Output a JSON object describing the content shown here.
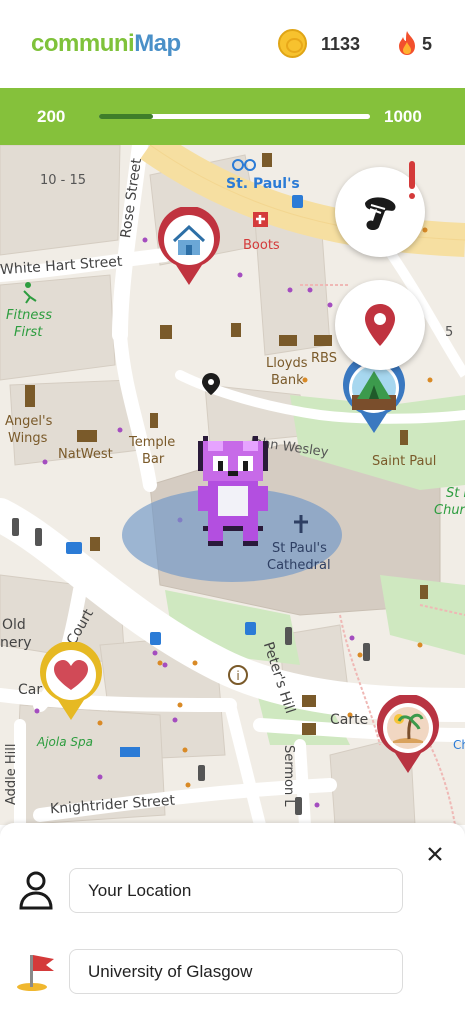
{
  "app": {
    "logo_part1": "communi",
    "logo_part2": "Map",
    "coins": "1133",
    "streak": "5"
  },
  "progress": {
    "min": "200",
    "max": "1000",
    "fraction": 0.2
  },
  "map": {
    "street_labels": {
      "rose_street": "Rose Street",
      "white_hart": "White Hart Street",
      "st_pauls_station": "St. Paul's",
      "block_10_15": "10 - 15",
      "lloyds": "Lloyds",
      "bank": "Bank",
      "rbs": "RBS",
      "boots": "Boots",
      "fitness": "Fitness",
      "first": "First",
      "angels": "Angel's",
      "wings": "Wings",
      "natwest": "NatWest",
      "temple": "Temple",
      "bar": "Bar",
      "john_wesley": "John Wesley",
      "saint_paul": "Saint Paul",
      "st_pauls_cathedral_1": "St Paul's",
      "st_pauls_cathedral_2": "Cathedral",
      "st_r": "St R",
      "chur": "Chur",
      "old": "Old",
      "nery": "nery",
      "car": "Car",
      "court": "s Court",
      "peters_hill": "Peter's Hill",
      "carter": "Carte",
      "ajola_spa": "Ajola Spa",
      "addle_hill": "Addle Hill",
      "sermon_lane": "Sermon L",
      "knightrider": "Knightrider Street",
      "num_5": "5",
      "ch": "Ch"
    }
  },
  "route": {
    "from_value": "Your Location",
    "to_value": "University of Glasgow"
  },
  "colors": {
    "brand_green": "#85c13b",
    "brand_blue": "#4a90c8",
    "marker_red": "#c0333f",
    "marker_blue": "#3a78c0",
    "marker_yellow": "#e6b923"
  },
  "icons": {
    "coin": "coin-icon",
    "streak": "flame-icon",
    "quest": "scroll-icon",
    "pin": "location-pin-icon",
    "home": "home-icon",
    "camp": "tent-icon",
    "heart": "heart-icon",
    "beach": "palm-tree-icon",
    "user": "user-icon",
    "flag": "flag-icon",
    "close": "close-icon"
  }
}
